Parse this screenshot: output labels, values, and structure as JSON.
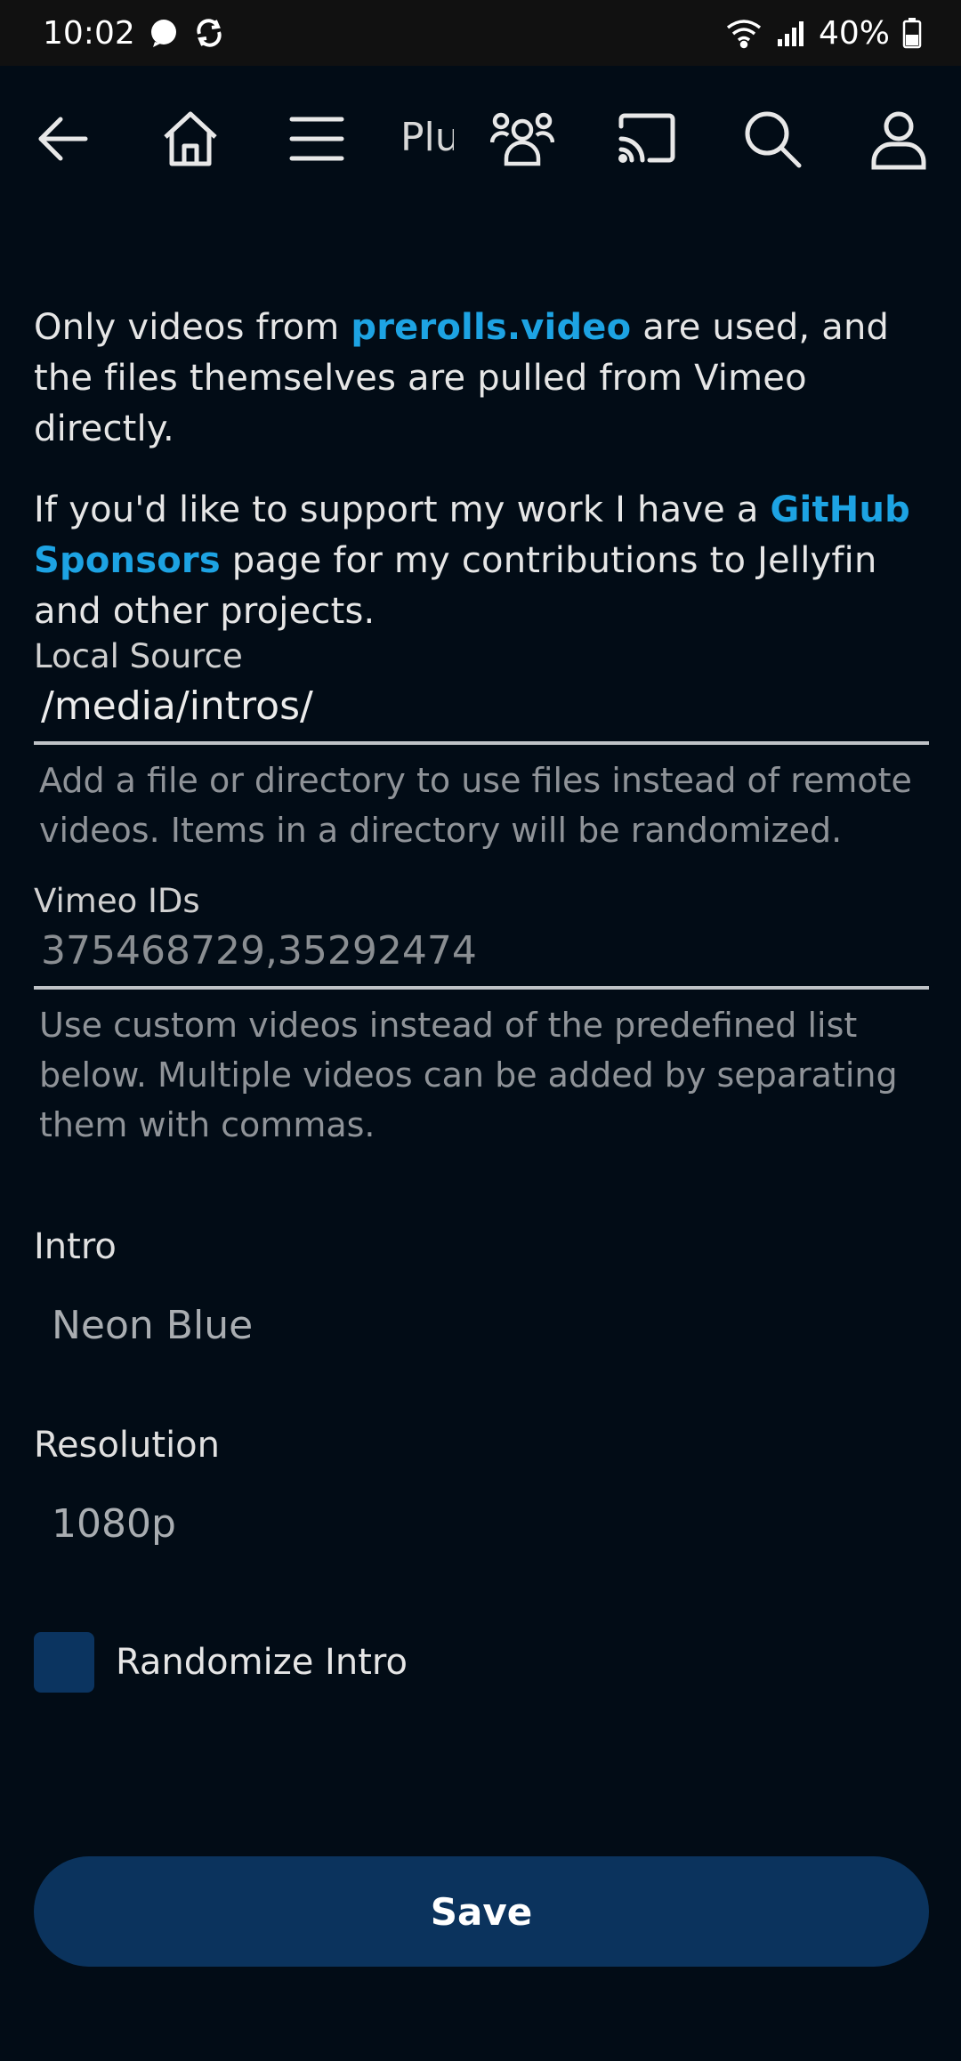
{
  "status_bar": {
    "time": "10:02",
    "battery": "40%"
  },
  "header": {
    "title": "Plugins",
    "icons": [
      "back-arrow-icon",
      "home-icon",
      "menu-icon",
      "users-icon",
      "cast-icon",
      "search-icon",
      "user-icon"
    ]
  },
  "intro_text": {
    "p1_before": "Only videos from ",
    "p1_link": "prerolls.video",
    "p1_after": " are used, and the files themselves are pulled from Vimeo directly.",
    "p2_before": "If you'd like to support my work I have a ",
    "p2_link": "GitHub Sponsors",
    "p2_after": " page for my contributions to Jellyfin and other projects."
  },
  "local_source": {
    "label": "Local Source",
    "value": "/media/intros/",
    "help": "Add a file or directory to use files instead of remote videos. Items in a directory will be randomized."
  },
  "vimeo_ids": {
    "label": "Vimeo IDs",
    "placeholder": "375468729,35292474",
    "help": "Use custom videos instead of the predefined list below. Multiple videos can be added by separating them with commas."
  },
  "intro_select": {
    "label": "Intro",
    "value": "Neon Blue"
  },
  "resolution_select": {
    "label": "Resolution",
    "value": "1080p"
  },
  "randomize": {
    "label": "Randomize Intro",
    "checked": false
  },
  "save_label": "Save",
  "colors": {
    "background": "#020c16",
    "link": "#1da3e3",
    "button": "#0b335d",
    "checkbox": "#0b3460"
  }
}
